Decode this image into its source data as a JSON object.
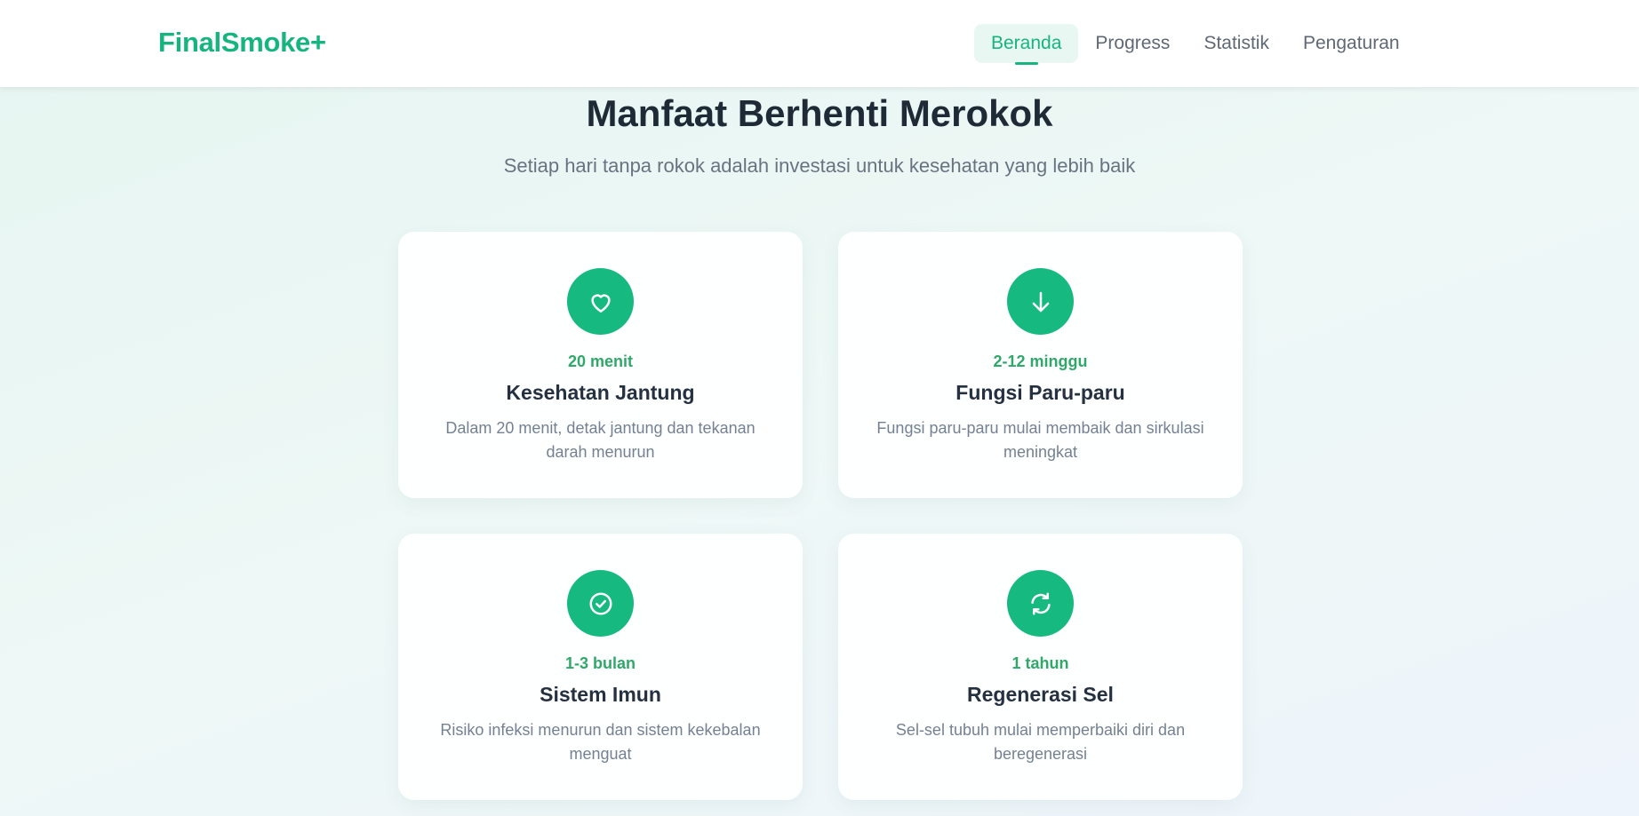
{
  "app": {
    "logo": "FinalSmoke+"
  },
  "nav": {
    "items": [
      {
        "label": "Beranda",
        "active": true
      },
      {
        "label": "Progress",
        "active": false
      },
      {
        "label": "Statistik",
        "active": false
      },
      {
        "label": "Pengaturan",
        "active": false
      }
    ]
  },
  "hero": {
    "title": "Manfaat Berhenti Merokok",
    "subtitle": "Setiap hari tanpa rokok adalah investasi untuk kesehatan yang lebih baik"
  },
  "benefits": [
    {
      "icon": "heart-icon",
      "period": "20 menit",
      "title": "Kesehatan Jantung",
      "description": "Dalam 20 menit, detak jantung dan tekanan darah menurun"
    },
    {
      "icon": "arrow-down-icon",
      "period": "2-12 minggu",
      "title": "Fungsi Paru-paru",
      "description": "Fungsi paru-paru mulai membaik dan sirkulasi meningkat"
    },
    {
      "icon": "check-circle-icon",
      "period": "1-3 bulan",
      "title": "Sistem Imun",
      "description": "Risiko infeksi menurun dan sistem kekebalan menguat"
    },
    {
      "icon": "refresh-icon",
      "period": "1 tahun",
      "title": "Regenerasi Sel",
      "description": "Sel-sel tubuh mulai memperbaiki diri dan beregenerasi"
    }
  ],
  "colors": {
    "brand": "#16b47e",
    "icon_bg": "#16b97f",
    "period_text": "#2fa86a",
    "title_text": "#1f2a37",
    "muted_text": "#687382"
  }
}
